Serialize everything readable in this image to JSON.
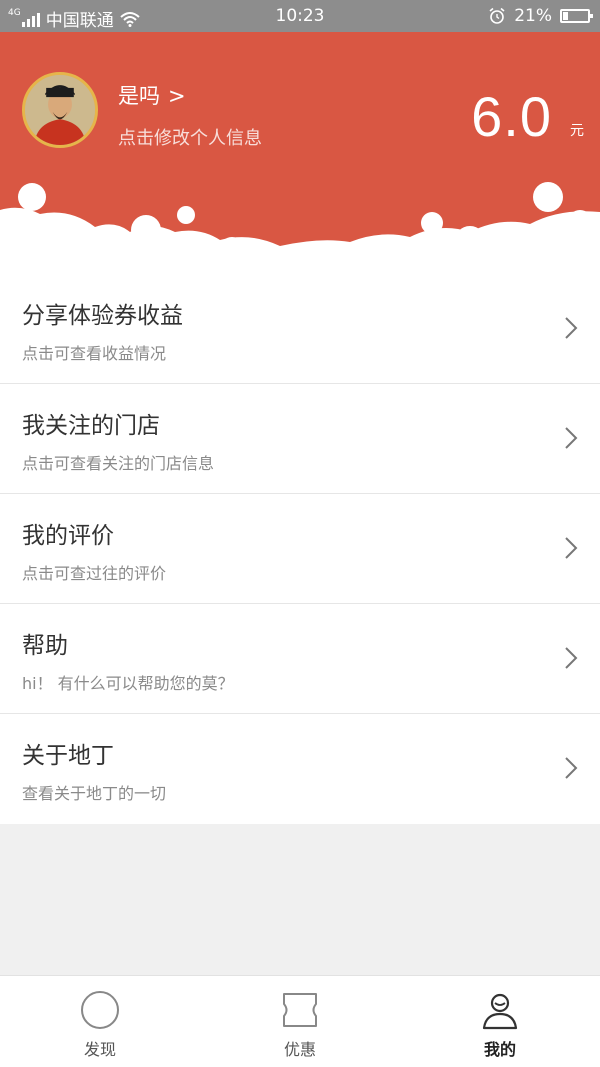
{
  "status_bar": {
    "network_tag": "4G",
    "carrier": "中国联通",
    "time": "10:23",
    "battery_percent": "21%",
    "battery_level": 0.21,
    "icons": [
      "signal-icon",
      "wifi-icon",
      "alarm-icon",
      "battery-icon"
    ]
  },
  "profile": {
    "username": "是吗",
    "username_chevron": ">",
    "hint": "点击修改个人信息",
    "balance": "6.0",
    "balance_unit": "元"
  },
  "menu": {
    "items": [
      {
        "title": "分享体验券收益",
        "subtitle": "点击可查看收益情况"
      },
      {
        "title": "我关注的门店",
        "subtitle": "点击可查看关注的门店信息"
      },
      {
        "title": "我的评价",
        "subtitle": "点击可查过往的评价"
      },
      {
        "title": "帮助",
        "subtitle": "hi！ 有什么可以帮助您的莫？"
      },
      {
        "title": "关于地丁",
        "subtitle": "查看关于地丁的一切"
      }
    ]
  },
  "tabbar": {
    "tabs": [
      {
        "label": "发现",
        "icon": "discover-icon",
        "active": false
      },
      {
        "label": "优惠",
        "icon": "coupon-icon",
        "active": false
      },
      {
        "label": "我的",
        "icon": "profile-icon",
        "active": true
      }
    ]
  },
  "colors": {
    "brand_red": "#d95743",
    "status_bar": "#8d8d8d",
    "background": "#f0f0f0"
  }
}
